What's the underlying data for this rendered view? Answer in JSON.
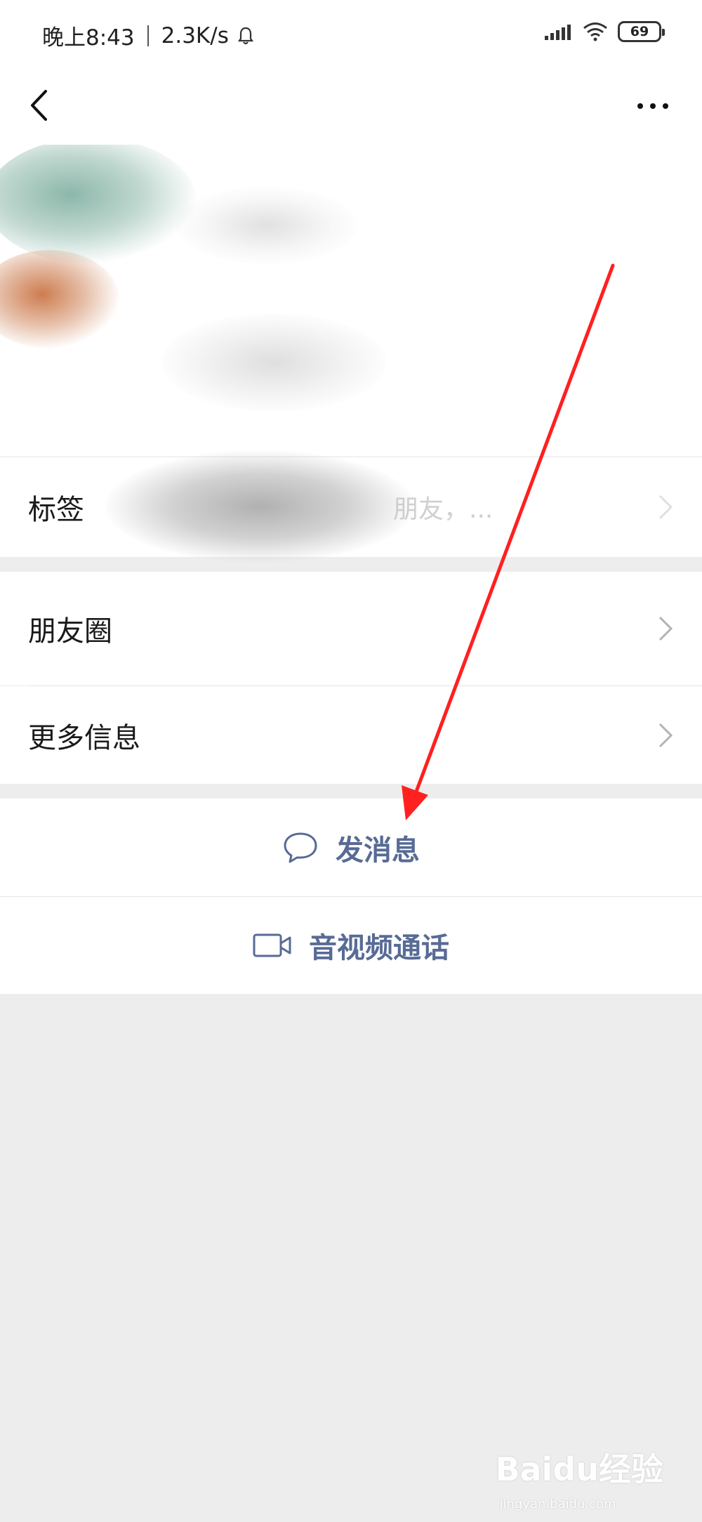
{
  "status_bar": {
    "time": "晚上8:43",
    "speed": "2.3K/s",
    "battery": "69"
  },
  "nav": {
    "back_icon": "chevron-left-icon",
    "more_icon": "more-horizontal-icon"
  },
  "profile": {
    "tags_label": "标签",
    "tags_value": "朋友，..."
  },
  "menu": {
    "moments_label": "朋友圈",
    "more_info_label": "更多信息"
  },
  "actions": {
    "send_message_label": "发消息",
    "video_call_label": "音视频通话"
  },
  "watermark": {
    "text": "Baidu经验",
    "sub": "jingyan.baidu.com"
  },
  "colors": {
    "link_blue": "#576b95",
    "annotation_red": "#ff2020",
    "background": "#ededed"
  }
}
